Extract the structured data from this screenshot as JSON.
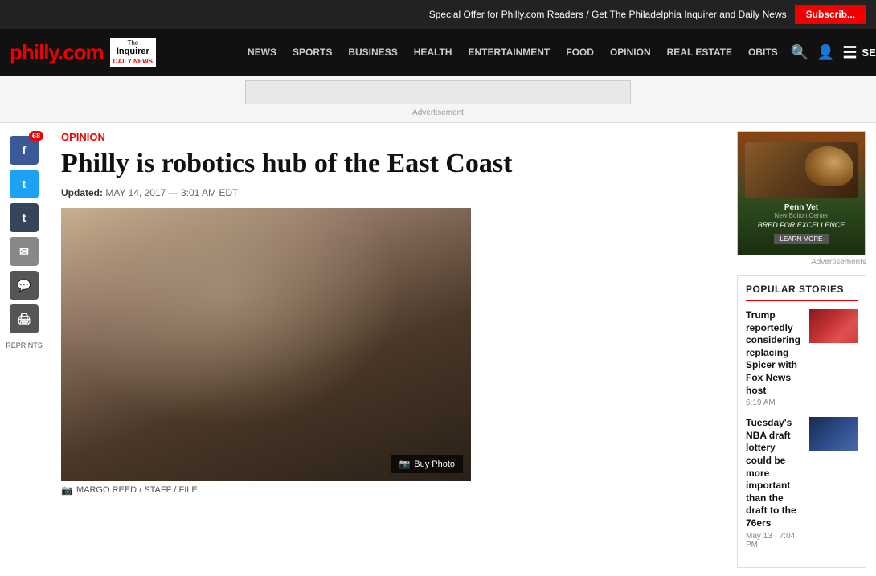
{
  "topBanner": {
    "text": "Special Offer for Philly.com Readers / Get The Philadelphia Inquirer and Daily News",
    "subscribeBtnLabel": "Subscrib..."
  },
  "header": {
    "logoPhilly": "philly",
    "logoPhillyDot": ".",
    "logoPhillyCom": "com",
    "logoInquirerThe": "The",
    "logoInquirerName": "Inquirer",
    "logoInquirerDaily": "DAILY NEWS",
    "navItems": [
      {
        "label": "NEWS",
        "id": "news"
      },
      {
        "label": "SPORTS",
        "id": "sports"
      },
      {
        "label": "BUSINESS",
        "id": "business"
      },
      {
        "label": "HEALTH",
        "id": "health"
      },
      {
        "label": "ENTERTAINMENT",
        "id": "entertainment"
      },
      {
        "label": "FOOD",
        "id": "food"
      },
      {
        "label": "OPINION",
        "id": "opinion"
      },
      {
        "label": "REAL ESTATE",
        "id": "real-estate"
      },
      {
        "label": "OBITS",
        "id": "obits"
      }
    ],
    "sectionsLabel": "SECTIONS"
  },
  "adBar": {
    "adLabel": "Advertisement"
  },
  "social": {
    "fbCount": "68",
    "reprintsLabel": "REPRINTS"
  },
  "article": {
    "category": "Opinion",
    "title": "Philly is robotics hub of the East Coast",
    "updatedLabel": "Updated:",
    "date": "MAY 14, 2017 — 3:01 AM EDT",
    "imageCredit": "MARGO REED / STAFF / FILE",
    "buyPhotoLabel": "Buy Photo"
  },
  "sidebar": {
    "adLabel": "Advertisements",
    "pennVetName": "Penn Vet",
    "pennVetSub": "New Bolton Center",
    "pennVetBred": "BRED FOR EXCELLENCE",
    "pennVetLearn": "LEARN MORE",
    "popularTitle": "POPULAR STORIES",
    "popularItems": [
      {
        "headline": "Trump reportedly considering replacing Spicer with Fox News host",
        "time": "6:19 AM"
      },
      {
        "headline": "Tuesday's NBA draft lottery could be more important than the draft to the 76ers",
        "time": "May 13 · 7:04 PM"
      }
    ]
  }
}
